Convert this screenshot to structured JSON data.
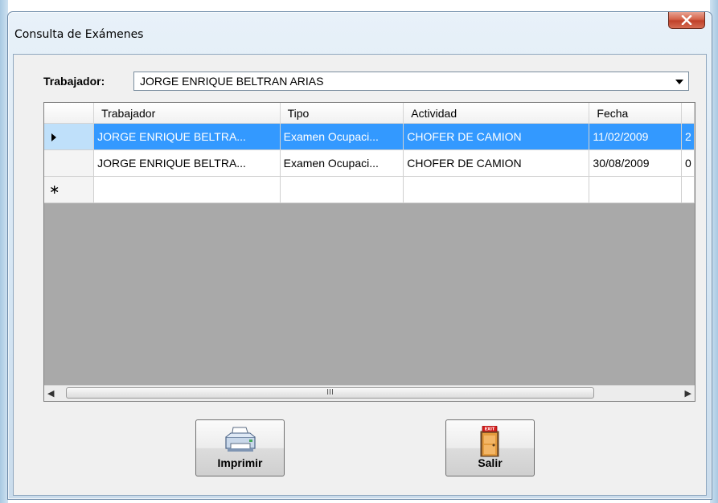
{
  "window": {
    "title": "Consulta de Exámenes"
  },
  "form": {
    "worker_label": "Trabajador:",
    "worker_value": "JORGE ENRIQUE BELTRAN ARIAS"
  },
  "grid": {
    "columns": [
      "Trabajador",
      "Tipo",
      "Actividad",
      "Fecha",
      ""
    ],
    "rows": [
      {
        "selected": true,
        "cells": [
          "JORGE ENRIQUE BELTRA...",
          "Examen Ocupaci...",
          "CHOFER DE CAMION",
          "11/02/2009",
          "2"
        ]
      },
      {
        "selected": false,
        "cells": [
          "JORGE ENRIQUE BELTRA...",
          "Examen Ocupaci...",
          "CHOFER DE CAMION",
          "30/08/2009",
          "0"
        ]
      }
    ],
    "new_row_marker": "∗",
    "scrollbar_grip": "III"
  },
  "buttons": {
    "print_label": "Imprimir",
    "exit_label": "Salir",
    "exit_sign_text": "EXIT"
  },
  "icons": [
    "close-icon",
    "printer-icon",
    "exit-door-icon",
    "row-pointer-icon",
    "scroll-left-icon",
    "scroll-right-icon",
    "dropdown-arrow-icon"
  ]
}
